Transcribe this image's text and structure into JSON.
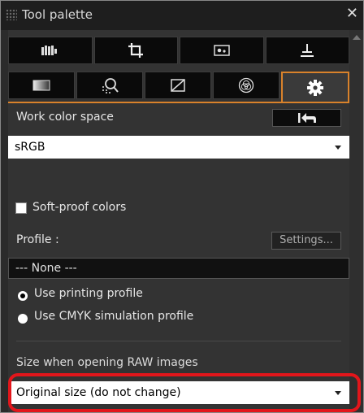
{
  "window": {
    "title": "Tool palette",
    "close_glyph": "✕"
  },
  "tabs_row1": [
    {
      "icon": "histogram-icon"
    },
    {
      "icon": "crop-icon"
    },
    {
      "icon": "image-icon"
    },
    {
      "icon": "stamp-icon"
    }
  ],
  "tabs_row2": [
    {
      "icon": "exposure-icon"
    },
    {
      "icon": "lens-magnifier-icon"
    },
    {
      "icon": "tone-curve-icon"
    },
    {
      "icon": "color-circles-icon"
    },
    {
      "icon": "gear-icon",
      "active": true
    }
  ],
  "work_color_space": {
    "label": "Work color space",
    "value": "sRGB",
    "reset_icon": "reset-to-start-icon"
  },
  "soft_proof": {
    "label": "Soft-proof colors",
    "checked": false
  },
  "profile": {
    "label": "Profile :",
    "settings_label": "Settings...",
    "value": "--- None ---"
  },
  "radio_options": [
    {
      "label": "Use printing profile",
      "selected": true
    },
    {
      "label": "Use CMYK simulation profile",
      "selected": false
    }
  ],
  "raw_size": {
    "label": "Size when opening RAW images",
    "value": "Original size (do not change)"
  },
  "colors": {
    "accent": "#d9822b",
    "highlight": "#e2161b",
    "panel_bg": "#333333"
  }
}
